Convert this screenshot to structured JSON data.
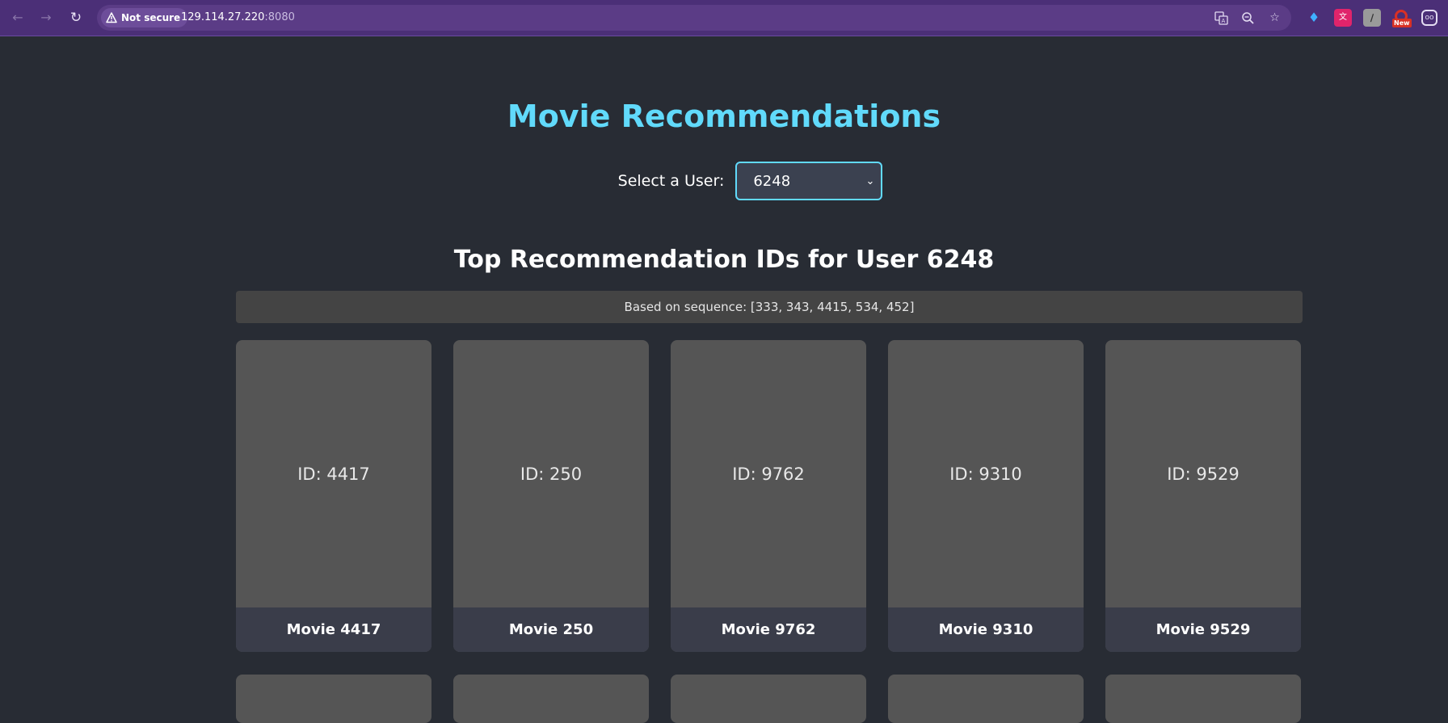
{
  "browser": {
    "security_label": "Not secure",
    "url_host": "129.114.27.220",
    "url_port": ":8080",
    "icons": [
      "back-arrow-icon",
      "forward-arrow-icon",
      "reload-icon",
      "warning-icon",
      "translate-icon",
      "zoom-icon",
      "star-icon"
    ],
    "extensions": [
      "gem-extension-icon",
      "pink-extension-icon",
      "gray-extension-icon",
      "red-extension-icon",
      "dashboard-extension-icon"
    ],
    "new_badge": "New"
  },
  "app": {
    "title": "Movie Recommendations",
    "user_label": "Select a User:",
    "selected_user": "6248",
    "subtitle": "Top Recommendation IDs for User 6248",
    "sequence_text": "Based on sequence: [333, 343, 4415, 534, 452]"
  },
  "movies": [
    {
      "id_label": "ID: 4417",
      "title": "Movie 4417"
    },
    {
      "id_label": "ID: 250",
      "title": "Movie 250"
    },
    {
      "id_label": "ID: 9762",
      "title": "Movie 9762"
    },
    {
      "id_label": "ID: 9310",
      "title": "Movie 9310"
    },
    {
      "id_label": "ID: 9529",
      "title": "Movie 9529"
    }
  ],
  "colors": {
    "accent": "#61dafb",
    "background": "#282c34",
    "card": "#555555",
    "caption": "#3a3d4a",
    "chrome": "#4b2f77"
  }
}
